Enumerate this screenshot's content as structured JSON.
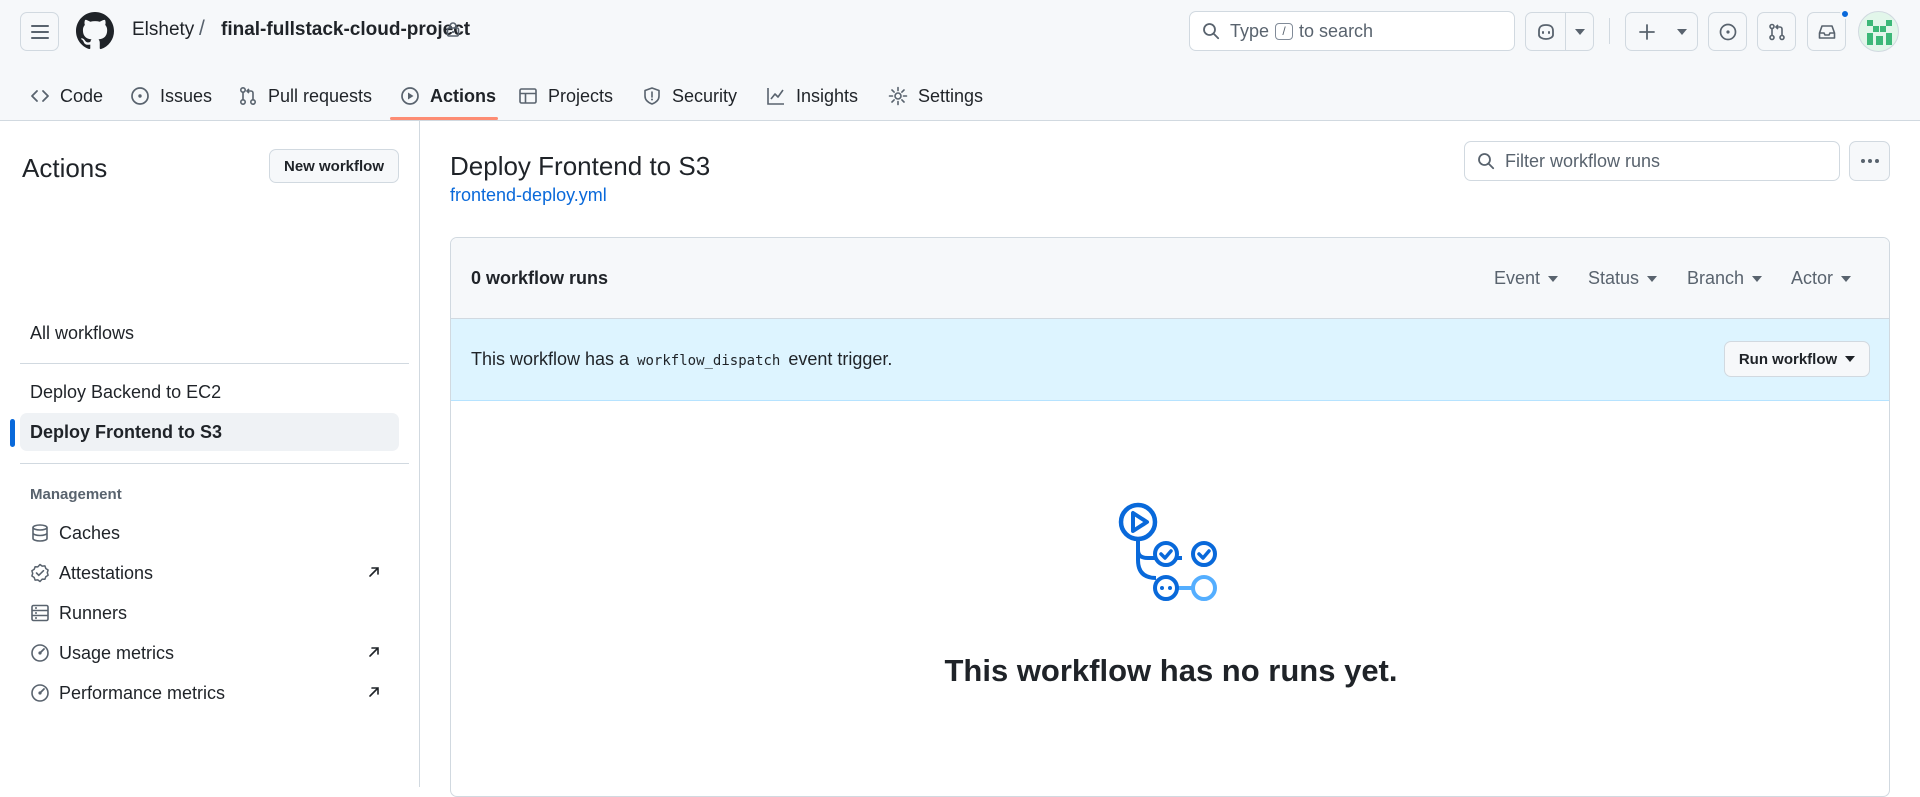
{
  "header": {
    "owner": "Elshety",
    "separator": "/",
    "repo": "final-fullstack-cloud-project",
    "search": {
      "before": "Type",
      "key": "/",
      "after": "to search"
    }
  },
  "repo_nav": {
    "tabs": [
      {
        "label": "Code",
        "icon": "code-icon"
      },
      {
        "label": "Issues",
        "icon": "issue-opened-icon"
      },
      {
        "label": "Pull requests",
        "icon": "git-pull-request-icon"
      },
      {
        "label": "Actions",
        "icon": "play-icon",
        "active": true
      },
      {
        "label": "Projects",
        "icon": "table-icon"
      },
      {
        "label": "Security",
        "icon": "shield-icon"
      },
      {
        "label": "Insights",
        "icon": "graph-icon"
      },
      {
        "label": "Settings",
        "icon": "gear-icon"
      }
    ]
  },
  "sidebar": {
    "title": "Actions",
    "new_workflow_label": "New workflow",
    "all_workflows": "All workflows",
    "workflows": [
      {
        "label": "Deploy Backend to EC2",
        "active": false
      },
      {
        "label": "Deploy Frontend to S3",
        "active": true
      }
    ],
    "management_heading": "Management",
    "management": [
      {
        "label": "Caches",
        "icon": "database-icon",
        "external": false
      },
      {
        "label": "Attestations",
        "icon": "verified-icon",
        "external": true
      },
      {
        "label": "Runners",
        "icon": "server-icon",
        "external": false
      },
      {
        "label": "Usage metrics",
        "icon": "meter-icon",
        "external": true
      },
      {
        "label": "Performance metrics",
        "icon": "meter-icon",
        "external": true
      }
    ]
  },
  "main": {
    "title": "Deploy Frontend to S3",
    "file": "frontend-deploy.yml",
    "filter_placeholder": "Filter workflow runs",
    "run_count": "0 workflow runs",
    "filters": [
      "Event",
      "Status",
      "Branch",
      "Actor"
    ],
    "dispatch": {
      "before": "This workflow has a",
      "code": "workflow_dispatch",
      "after": "event trigger."
    },
    "run_workflow_label": "Run workflow",
    "empty_message": "This workflow has no runs yet."
  },
  "colors": {
    "accent": "#0969da",
    "tab_underline": "#fd8c73",
    "dispatch_bg": "#ddf4ff",
    "empty_icon_blue": "#0969da",
    "empty_icon_light": "#54aeff"
  }
}
